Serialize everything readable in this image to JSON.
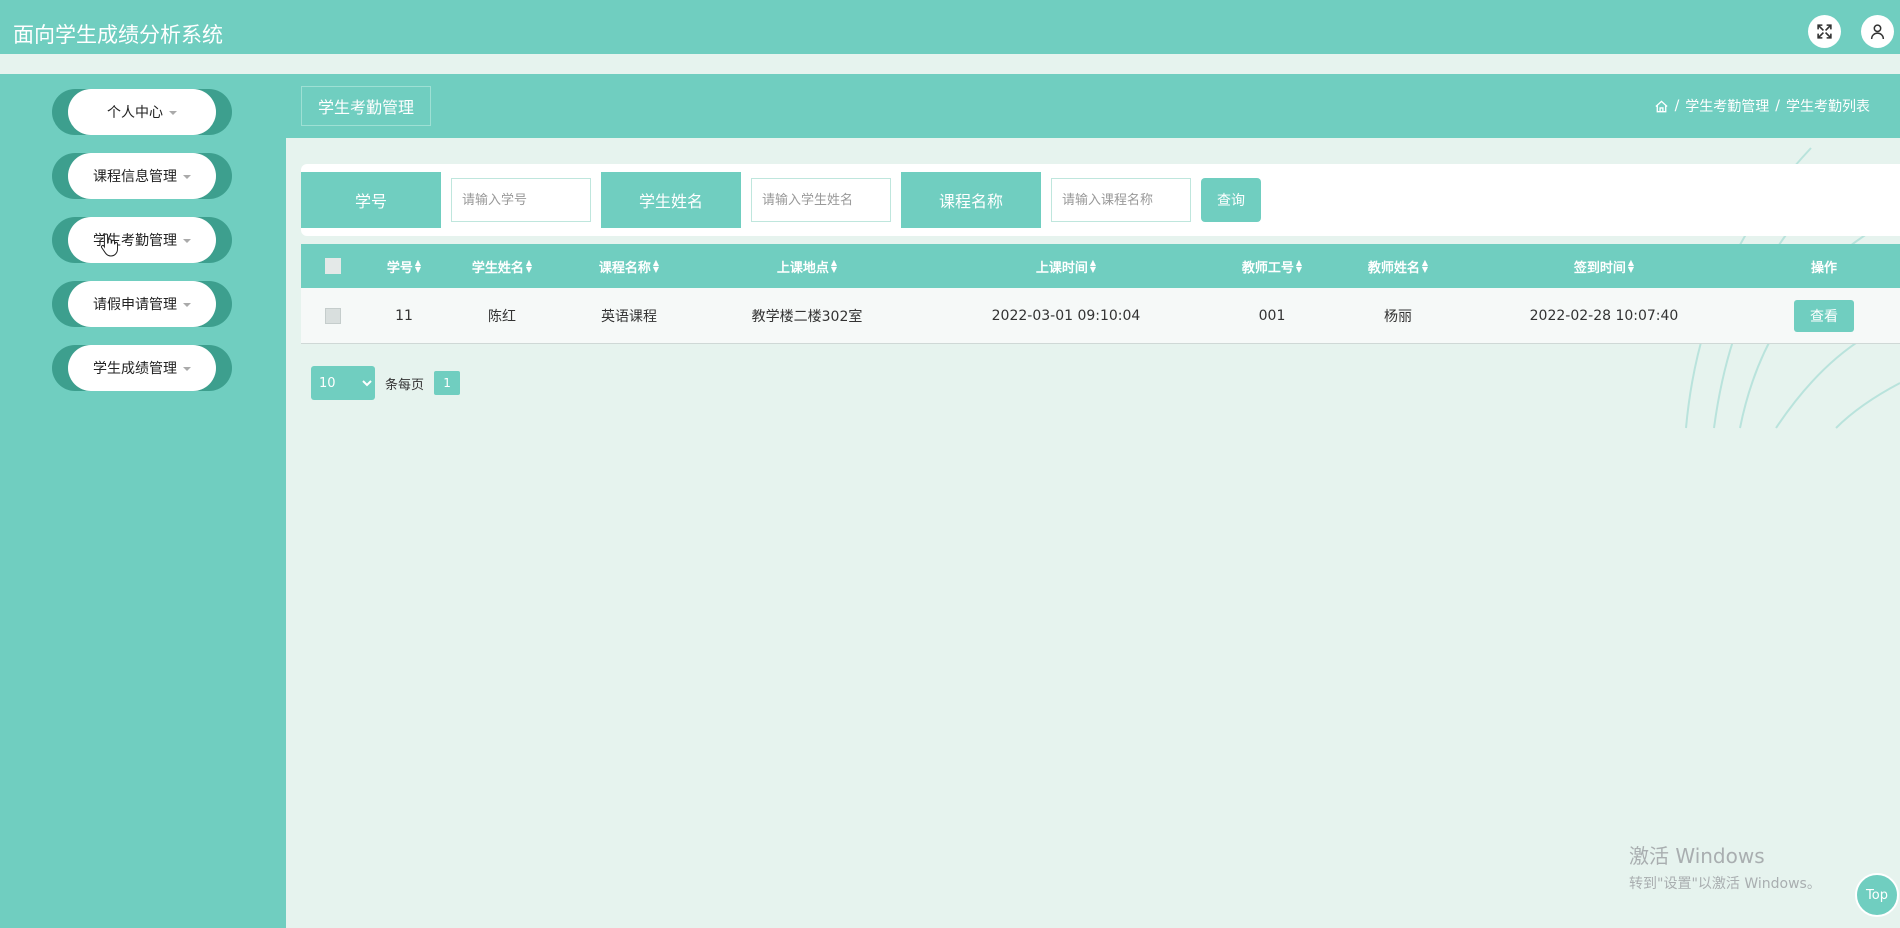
{
  "app": {
    "title": "面向学生成绩分析系统"
  },
  "colors": {
    "primary": "#70cec0",
    "menu_edge": "#3d9f8e",
    "content_bg": "#e6f3ee"
  },
  "top_icons": [
    "fullscreen-icon",
    "user-icon"
  ],
  "sidebar": {
    "items": [
      {
        "label": "个人中心"
      },
      {
        "label": "课程信息管理"
      },
      {
        "label": "学生考勤管理"
      },
      {
        "label": "请假申请管理"
      },
      {
        "label": "学生成绩管理"
      }
    ]
  },
  "page": {
    "title": "学生考勤管理",
    "breadcrumb": {
      "home_icon": "home-icon",
      "sep": "/",
      "level1": "学生考勤管理",
      "level2": "学生考勤列表"
    }
  },
  "search": {
    "fields": [
      {
        "label": "学号",
        "placeholder": "请输入学号"
      },
      {
        "label": "学生姓名",
        "placeholder": "请输入学生姓名"
      },
      {
        "label": "课程名称",
        "placeholder": "请输入课程名称"
      }
    ],
    "query_label": "查询"
  },
  "table": {
    "headers": [
      "学号",
      "学生姓名",
      "课程名称",
      "上课地点",
      "上课时间",
      "教师工号",
      "教师姓名",
      "签到时间",
      "操作"
    ],
    "sort_glyph": "◆",
    "rows": [
      {
        "cells": [
          "11",
          "陈红",
          "英语课程",
          "教学楼二楼302室",
          "2022-03-01 09:10:04",
          "001",
          "杨丽",
          "2022-02-28 10:07:40"
        ],
        "action": "查看"
      }
    ]
  },
  "pager": {
    "page_size": "10",
    "page_size_options": [
      "10"
    ],
    "per_page_text": "条每页",
    "current_page": "1"
  },
  "watermark": {
    "line1": "激活 Windows",
    "line2": "转到\"设置\"以激活 Windows。"
  },
  "back_to_top": "Top"
}
